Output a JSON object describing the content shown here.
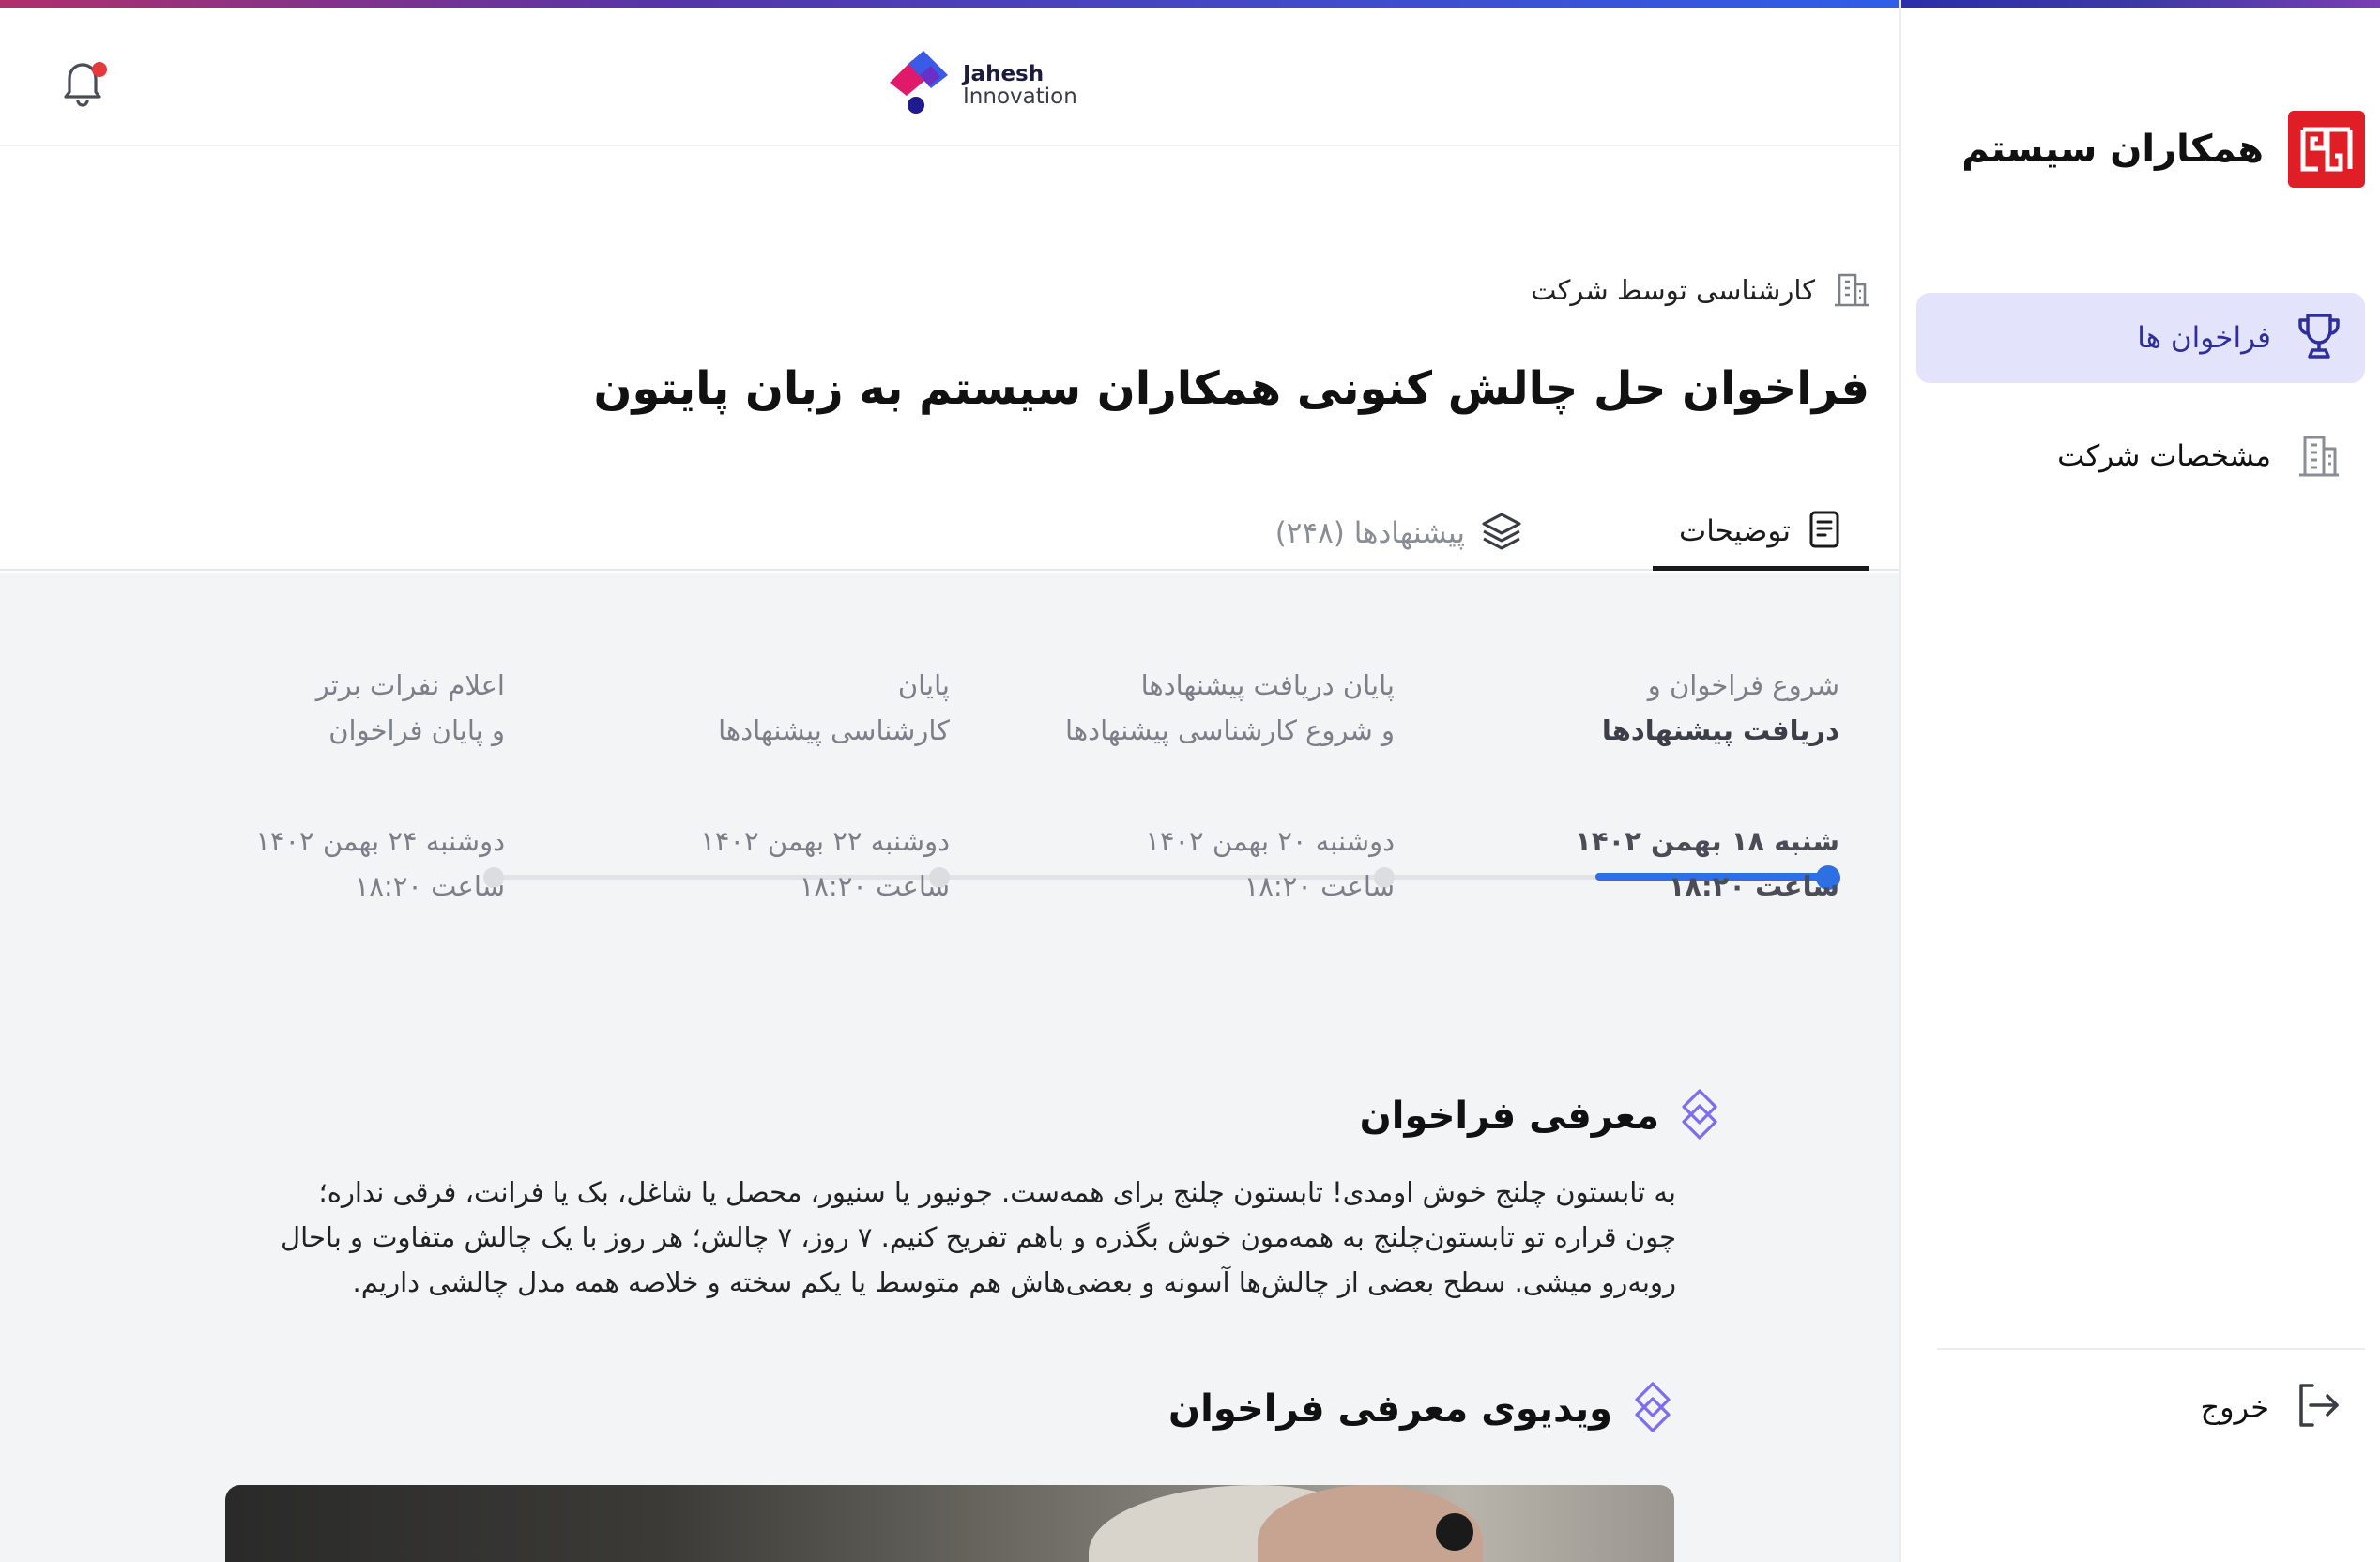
{
  "sidebar": {
    "brand_name": "همکاران سیستم",
    "nav": [
      {
        "label": "فراخوان ها",
        "icon": "trophy-icon",
        "active": true
      },
      {
        "label": "مشخصات شرکت",
        "icon": "building-icon",
        "active": false
      }
    ],
    "logout_label": "خروج"
  },
  "header": {
    "logo_line1": "Jahesh",
    "logo_line2": "Innovation"
  },
  "main": {
    "company_tag": "کارشناسی توسط شرکت",
    "title": "فراخوان حل چالش کنونی همکاران سیستم به زبان پایتون",
    "tabs": [
      {
        "label": "توضیحات",
        "icon": "document-icon",
        "active": true
      },
      {
        "label": "پیشنهادها (۲۴۸)",
        "icon": "layers-icon",
        "active": false
      }
    ]
  },
  "timeline": {
    "steps": [
      {
        "line1": "شروع فراخوان و",
        "line2": "دریافت پیشنهادها",
        "date": "شنبه ۱۸ بهمن ۱۴۰۲",
        "time": "ساعت ۱۸:۲۰",
        "active": true
      },
      {
        "line1": "پایان دریافت پیشنهادها",
        "line2": "و شروع کارشناسی پیشنهادها",
        "date": "دوشنبه ۲۰ بهمن ۱۴۰۲",
        "time": "ساعت ۱۸:۲۰",
        "active": false
      },
      {
        "line1": "پایان",
        "line2": "کارشناسی پیشنهادها",
        "date": "دوشنبه ۲۲ بهمن ۱۴۰۲",
        "time": "ساعت ۱۸:۲۰",
        "active": false
      },
      {
        "line1": "اعلام نفرات برتر",
        "line2": "و پایان فراخوان",
        "date": "دوشنبه ۲۴ بهمن ۱۴۰۲",
        "time": "ساعت ۱۸:۲۰",
        "active": false
      }
    ]
  },
  "intro": {
    "heading": "معرفی فراخوان",
    "line1": "به تابستون چلنج خوش اومدی! تابستون چلنج برای همه‌ست. جونیور یا سنیور، محصل یا شاغل، بک یا فرانت، فرقی نداره؛",
    "line2": "چون قراره تو تابستون‌چلنج به همه‌مون خوش بگذره و باهم تفریح کنیم. ۷ روز، ۷ چالش؛ هر روز با یک چالش متفاوت و باحال",
    "line3": "روبه‌رو میشی. سطح بعضی از چالش‌ها آسونه و بعضی‌هاش هم متوسط یا یکم سخته و خلاصه همه مدل چالشی داریم."
  },
  "video": {
    "heading": "ویدیوی معرفی فراخوان"
  },
  "colors": {
    "accent": "#2f6fe4",
    "nav_active_bg": "#e3e4fb",
    "brand_red": "#e01e26"
  }
}
